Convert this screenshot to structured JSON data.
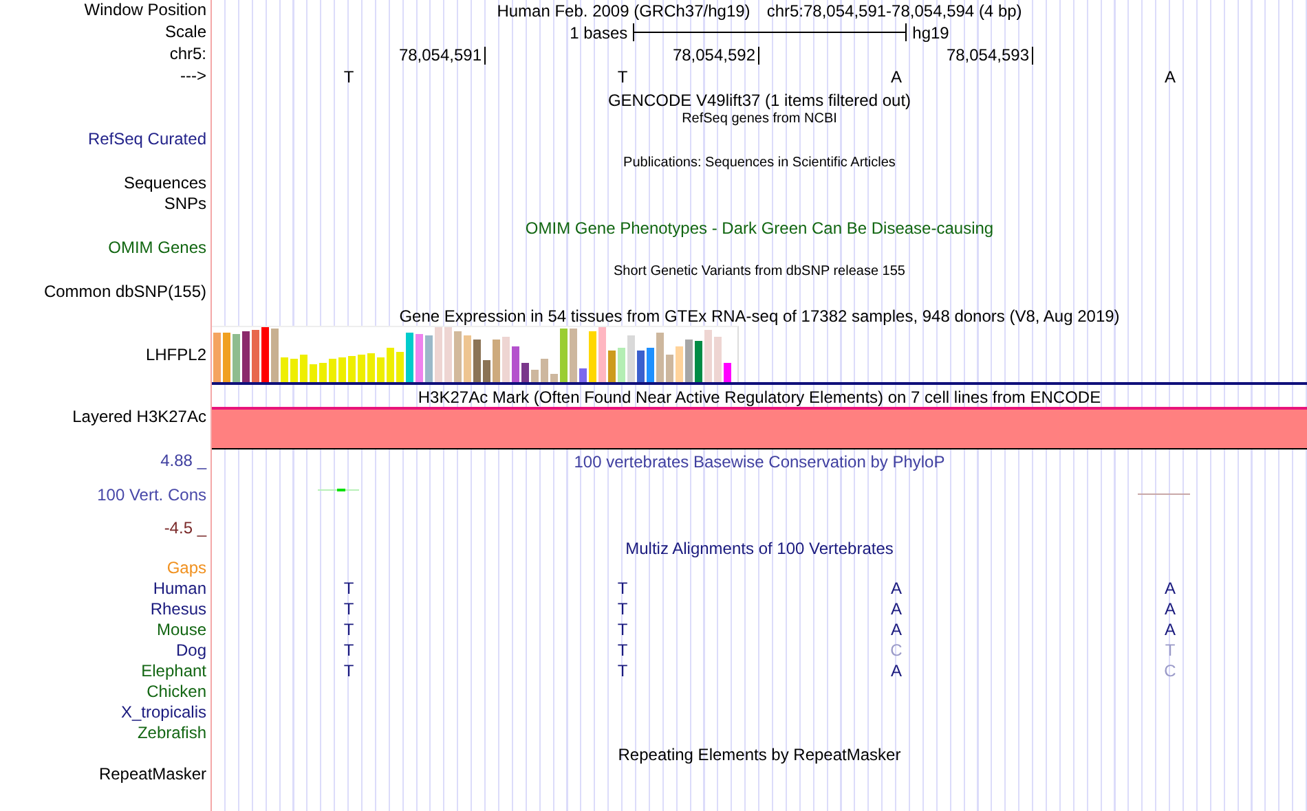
{
  "position": {
    "label": "Window Position",
    "assembly": "Human Feb. 2009 (GRCh37/hg19)",
    "range": "chr5:78,054,591-78,054,594 (4 bp)"
  },
  "scale": {
    "label": "Scale",
    "span": "1 bases",
    "assembly": "hg19"
  },
  "ruler": {
    "label": "chr5:",
    "ticks": [
      "78,054,591",
      "78,054,592",
      "78,054,593"
    ]
  },
  "strand": {
    "label": "--->",
    "bases": [
      "T",
      "T",
      "A",
      "A"
    ]
  },
  "tracks": [
    {
      "kind": "track",
      "title": "GENCODE V49lift37 (1 items filtered out)",
      "color": "#000000"
    },
    {
      "kind": "note",
      "title": "RefSeq genes from NCBI",
      "color": "#000000",
      "labels": [
        {
          "text": "RefSeq Curated",
          "color": "#23238a"
        }
      ]
    },
    {
      "kind": "note",
      "title": "Publications: Sequences in Scientific Articles",
      "color": "#000000",
      "labels": [
        {
          "text": "Sequences",
          "color": "#000000"
        },
        {
          "text": "SNPs",
          "color": "#000000"
        }
      ]
    },
    {
      "kind": "track",
      "title": "OMIM Gene Phenotypes - Dark Green Can Be Disease-causing",
      "color": "#116611",
      "labels": [
        {
          "text": "OMIM Genes",
          "color": "#116611"
        }
      ]
    },
    {
      "kind": "note",
      "title": "Short Genetic Variants from dbSNP release 155",
      "color": "#000000",
      "labels": [
        {
          "text": "Common dbSNP(155)",
          "color": "#000000"
        }
      ]
    }
  ],
  "expression": {
    "title": "Gene Expression in 54 tissues from GTEx RNA-seq of 17382 samples, 948 donors (V8, Aug 2019)",
    "label": "LHFPL2"
  },
  "signal": {
    "title": "H3K27Ac Mark (Often Found Near Active Regulatory Elements) on 7 cell lines from ENCODE",
    "label": "Layered H3K27Ac"
  },
  "conservation": {
    "title": "100 vertebrates Basewise Conservation by PhyloP",
    "max_label": "4.88 _",
    "label": "100 Vert. Cons",
    "min_label": "-4.5 _"
  },
  "alignment": {
    "title": "Multiz Alignments of 100 Vertebrates",
    "gaps_label": "Gaps",
    "species": [
      {
        "name": "Human",
        "color": "#1a1a7e",
        "bases": [
          {
            "letter": "T",
            "match": true
          },
          {
            "letter": "T",
            "match": true
          },
          {
            "letter": "A",
            "match": true
          },
          {
            "letter": "A",
            "match": true
          }
        ]
      },
      {
        "name": "Rhesus",
        "color": "#1a1a7e",
        "bases": [
          {
            "letter": "T",
            "match": true
          },
          {
            "letter": "T",
            "match": true
          },
          {
            "letter": "A",
            "match": true
          },
          {
            "letter": "A",
            "match": true
          }
        ]
      },
      {
        "name": "Mouse",
        "color": "#136613",
        "bases": [
          {
            "letter": "T",
            "match": true
          },
          {
            "letter": "T",
            "match": true
          },
          {
            "letter": "A",
            "match": true
          },
          {
            "letter": "A",
            "match": true
          }
        ]
      },
      {
        "name": "Dog",
        "color": "#1a1a7e",
        "bases": [
          {
            "letter": "T",
            "match": true
          },
          {
            "letter": "T",
            "match": true
          },
          {
            "letter": "C",
            "match": false
          },
          {
            "letter": "T",
            "match": false
          }
        ]
      },
      {
        "name": "Elephant",
        "color": "#136613",
        "bases": [
          {
            "letter": "T",
            "match": true
          },
          {
            "letter": "T",
            "match": true
          },
          {
            "letter": "A",
            "match": true
          },
          {
            "letter": "C",
            "match": false
          }
        ]
      },
      {
        "name": "Chicken",
        "color": "#136613"
      },
      {
        "name": "X_tropicalis",
        "color": "#1a1a7e"
      },
      {
        "name": "Zebrafish",
        "color": "#136613"
      }
    ]
  },
  "repeats": {
    "title": "Repeating Elements by RepeatMasker",
    "label": "RepeatMasker"
  }
}
